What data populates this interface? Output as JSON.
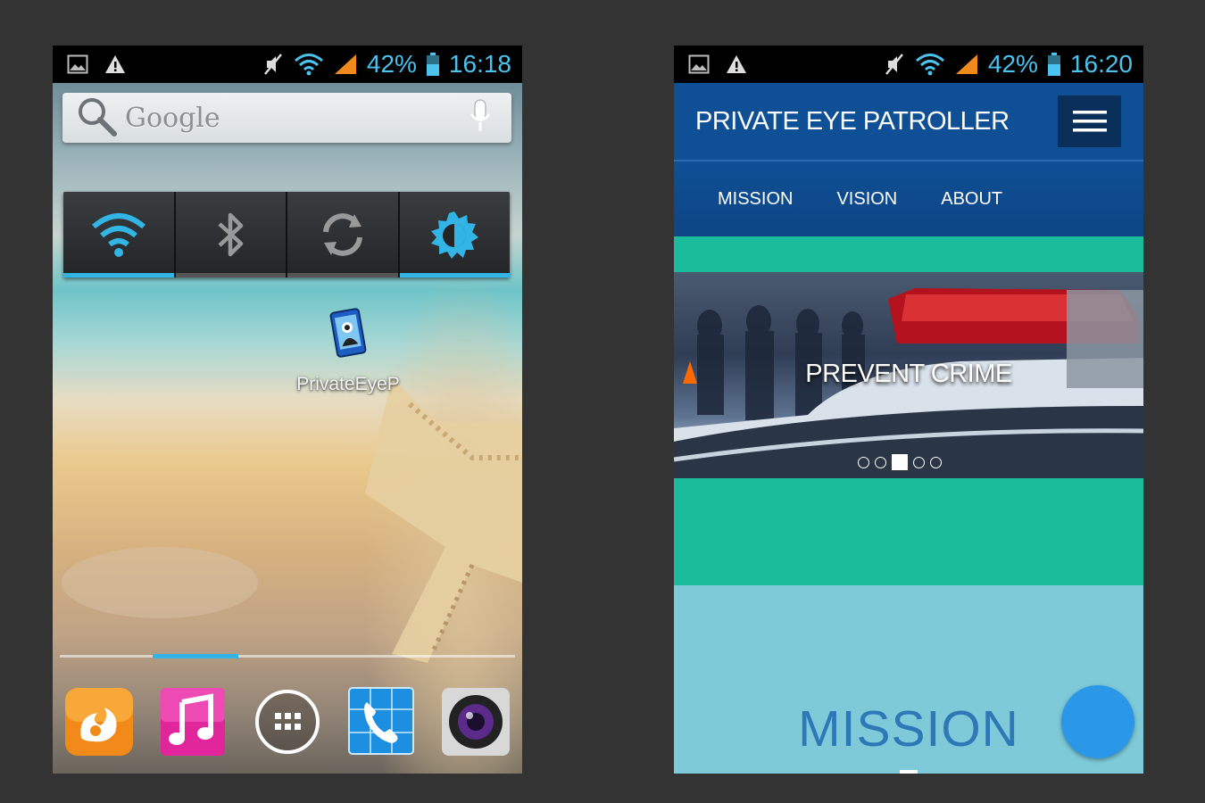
{
  "left_phone": {
    "status_bar": {
      "battery_percent": "42%",
      "time": "16:18",
      "icons": [
        "image-icon",
        "warning-icon",
        "mute-icon",
        "wifi-icon",
        "signal-icon",
        "battery-icon"
      ]
    },
    "search_bar": {
      "label": "Google",
      "icons": [
        "search-icon",
        "mic-icon"
      ]
    },
    "power_widget": {
      "toggles": [
        {
          "name": "wifi",
          "icon": "wifi-icon",
          "state": "on"
        },
        {
          "name": "bluetooth",
          "icon": "bluetooth-icon",
          "state": "off"
        },
        {
          "name": "sync",
          "icon": "sync-icon",
          "state": "off"
        },
        {
          "name": "brightness",
          "icon": "brightness-icon",
          "state": "on"
        }
      ]
    },
    "app_shortcut": {
      "label": "PrivateEyeP"
    },
    "dock": {
      "apps": [
        "uc-browser-icon",
        "music-icon",
        "app-drawer-icon",
        "phone-icon",
        "camera-icon"
      ]
    }
  },
  "right_phone": {
    "status_bar": {
      "battery_percent": "42%",
      "time": "16:20"
    },
    "header": {
      "brand": "PRIVATE EYE PATROLLER",
      "menu_icon": "hamburger-icon"
    },
    "nav": {
      "links": [
        "MISSION",
        "VISION",
        "ABOUT"
      ]
    },
    "slider": {
      "caption": "PREVENT CRIME",
      "dot_count": 5,
      "active_dot": 3
    },
    "mission": {
      "heading": "MISSION"
    },
    "colors": {
      "header_blue": "#0f4f95",
      "menu_button": "#0a2f5a",
      "teal": "#1abc9c",
      "light_teal": "#7ecad8",
      "fab_blue": "#2b97e8",
      "status_blue": "#4cc3ee"
    }
  }
}
